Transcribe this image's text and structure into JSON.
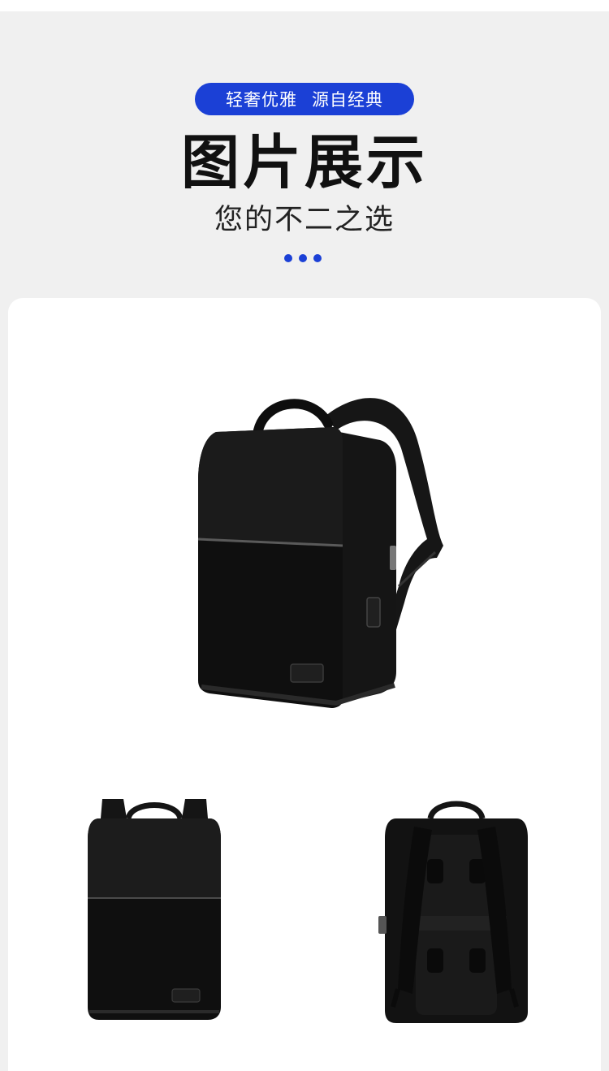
{
  "header": {
    "tag_left": "轻奢优雅",
    "tag_right": "源自经典",
    "title": "图片展示",
    "subtitle": "您的不二之选"
  },
  "colors": {
    "accent": "#1b40d6",
    "background": "#f0f0f0",
    "card": "#ffffff",
    "product": "#111111"
  },
  "gallery": [
    {
      "name": "backpack-three-quarter-view"
    },
    {
      "name": "backpack-front-view"
    },
    {
      "name": "backpack-back-view"
    }
  ]
}
